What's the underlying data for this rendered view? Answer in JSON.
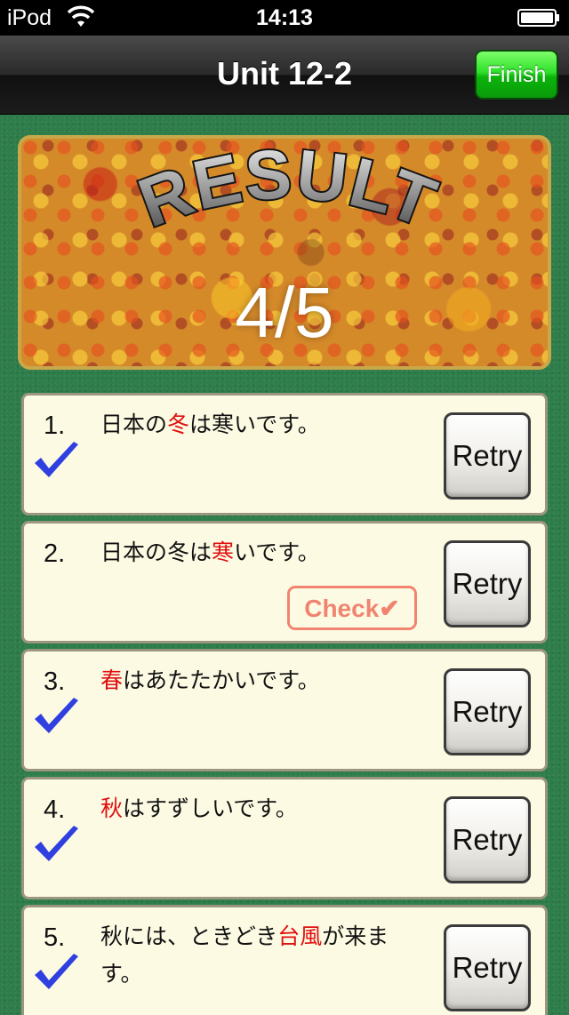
{
  "status_bar": {
    "carrier": "iPod",
    "time": "14:13"
  },
  "nav": {
    "title": "Unit 12-2",
    "finish_label": "Finish"
  },
  "result": {
    "title": "RESULT",
    "score": "4/5"
  },
  "retry_label": "Retry",
  "check_label": "Check✔",
  "questions": [
    {
      "number": "1.",
      "correct": true,
      "pre": "日本の",
      "keyword": "冬",
      "post": "は寒いです。"
    },
    {
      "number": "2.",
      "correct": false,
      "pre": "日本の冬は",
      "keyword": "寒",
      "post": "いです。"
    },
    {
      "number": "3.",
      "correct": true,
      "pre": "",
      "keyword": "春",
      "post": "はあたたかいです。"
    },
    {
      "number": "4.",
      "correct": true,
      "pre": "",
      "keyword": "秋",
      "post": "はすずしいです。"
    },
    {
      "number": "5.",
      "correct": true,
      "pre": "秋には、ときどき",
      "keyword": "台風",
      "post": "が来ます。"
    }
  ],
  "colors": {
    "background": "#2e7d4a",
    "keyword": "#e01010",
    "finish_button": "#1fcf1c",
    "check_mark": "#2f3fe0"
  }
}
